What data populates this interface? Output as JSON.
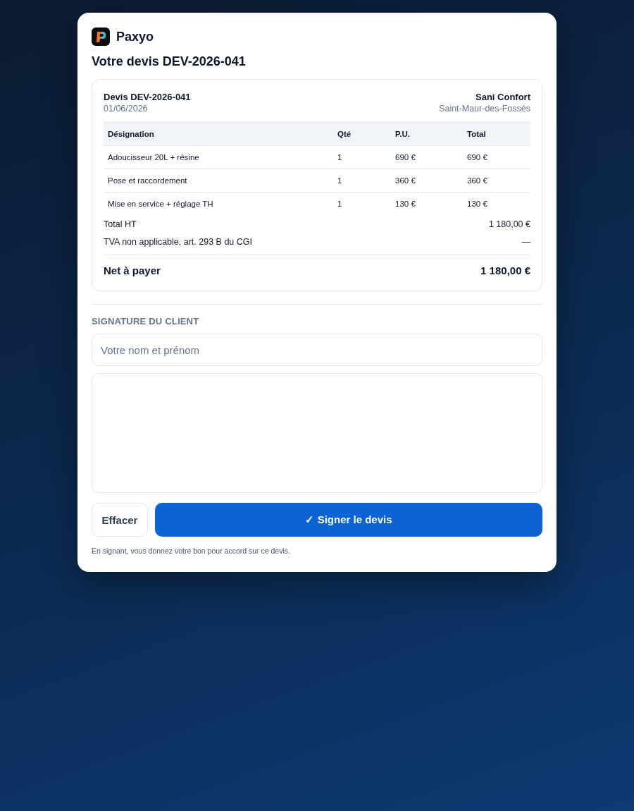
{
  "brand": {
    "name": "Paxyo"
  },
  "title": "Votre devis DEV-2026-041",
  "quote": {
    "number": "Devis DEV-2026-041",
    "date": "01/06/2026",
    "company": "Sani Confort",
    "city": "Saint-Maur-des-Fossés",
    "columns": [
      "Désignation",
      "Qté",
      "P.U.",
      "Total"
    ],
    "rows": [
      [
        "Adoucisseur 20L + résine",
        "1",
        "690 €",
        "690 €"
      ],
      [
        "Pose et raccordement",
        "1",
        "360 €",
        "360 €"
      ],
      [
        "Mise en service + réglage TH",
        "1",
        "130 €",
        "130 €"
      ]
    ],
    "totals": [
      {
        "kind": "line",
        "label": "Total HT",
        "value": "1 180,00 €"
      },
      {
        "kind": "line",
        "label": "TVA non applicable, art. 293 B du CGI",
        "value": "—"
      },
      {
        "kind": "grand",
        "label": "Net à payer",
        "value": "1 180,00 €"
      }
    ]
  },
  "signature": {
    "heading": "SIGNATURE DU CLIENT",
    "name_field": {
      "placeholder": "Votre nom et prénom"
    },
    "buttons": [
      {
        "kind": "secondary",
        "label": "Effacer"
      },
      {
        "kind": "primary",
        "label": "✓ Signer le devis"
      }
    ],
    "note": "En signant, vous donnez votre bon pour accord sur ce devis."
  }
}
